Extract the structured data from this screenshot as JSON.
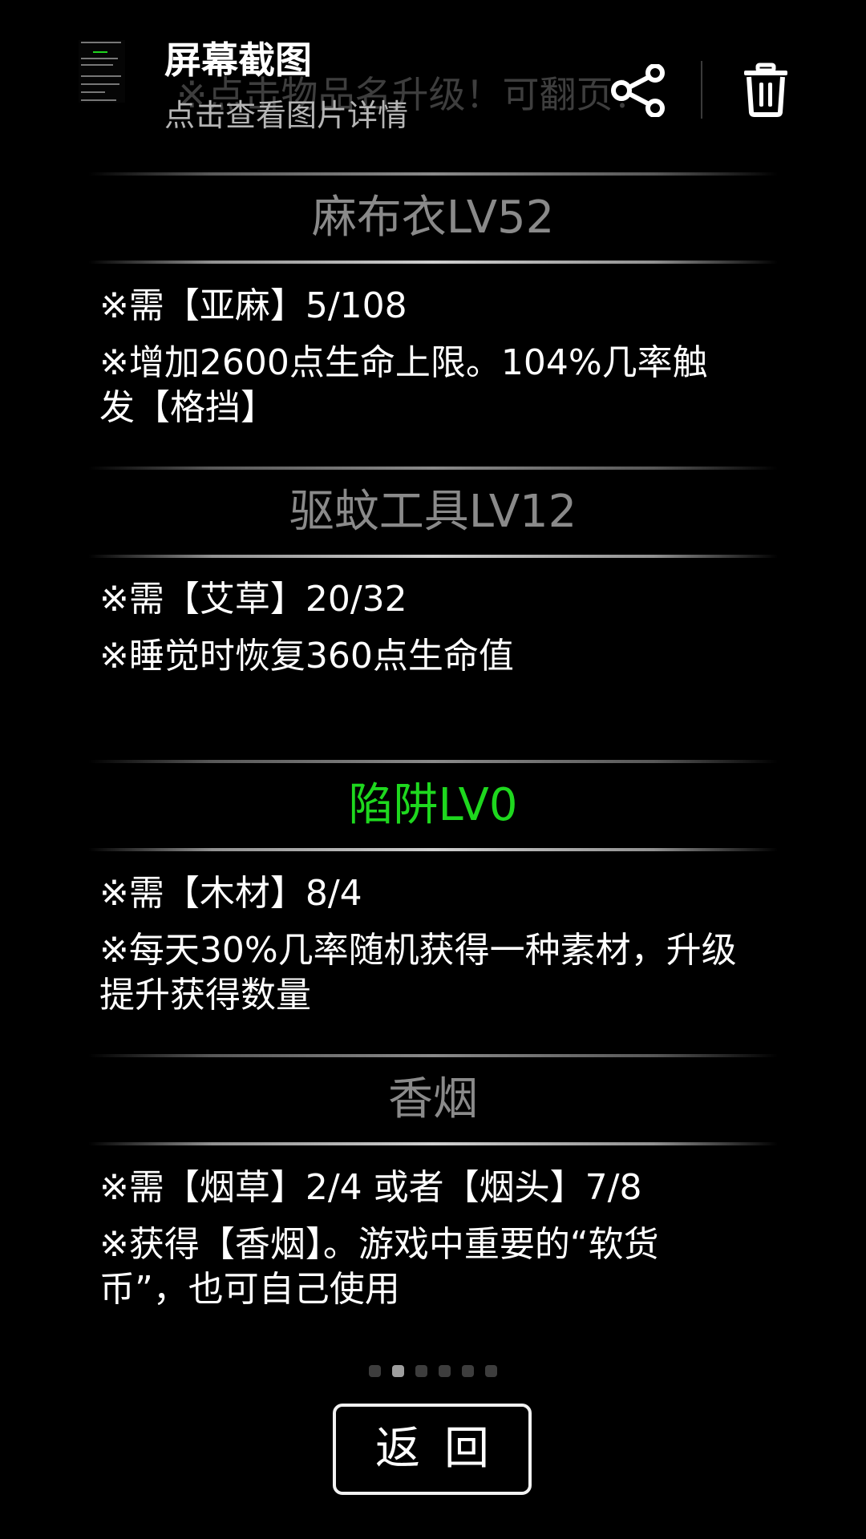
{
  "notification": {
    "title": "屏幕截图",
    "subtitle": "点击查看图片详情",
    "share_icon": "share-icon",
    "delete_icon": "trash-icon"
  },
  "hint": "※点击物品名升级！可翻页！",
  "items": [
    {
      "name": "麻布衣LV52",
      "active": false,
      "requirement": "※需【亚麻】5/108",
      "effect": "※增加2600点生命上限。104%几率触发【格挡】"
    },
    {
      "name": "驱蚊工具LV12",
      "active": false,
      "requirement": "※需【艾草】20/32",
      "effect": "※睡觉时恢复360点生命值"
    },
    {
      "name": "陷阱LV0",
      "active": true,
      "requirement": "※需【木材】8/4",
      "effect": "※每天30%几率随机获得一种素材，升级提升获得数量"
    },
    {
      "name": "香烟",
      "active": false,
      "requirement": "※需【烟草】2/4 或者【烟头】7/8",
      "effect": "※获得【香烟】。游戏中重要的“软货币”，也可自己使用"
    }
  ],
  "pager": {
    "total": 6,
    "current": 2
  },
  "back_label": "返回",
  "colors": {
    "background": "#000000",
    "active_title": "#1ed81e",
    "inactive_title": "#8a8a8a",
    "text": "#ffffff"
  }
}
